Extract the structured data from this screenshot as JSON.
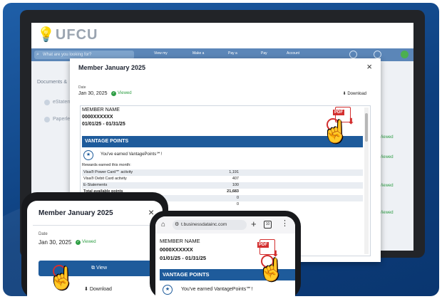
{
  "site": {
    "logo": "UFCU",
    "search_placeholder": "What are you looking for?",
    "nav": [
      "View my",
      "Make a",
      "Pay a",
      "Pay",
      "Account"
    ],
    "sidebar_title": "Documents &",
    "sidebar_items": [
      "eStatem",
      "Paperles"
    ],
    "viewed_label": "Viewed"
  },
  "modal": {
    "title": "Member January 2025",
    "close": "×",
    "date_label": "Date",
    "date": "Jan 30, 2025",
    "viewed": "Viewed",
    "download": "Download"
  },
  "statement": {
    "member_name": "MEMBER NAME",
    "account": "0000XXXXXX",
    "period": "01/01/25 - 01/31/25",
    "section_title": "VANTAGE POINTS",
    "earned_text": "You've earned VantagePoints℠!",
    "rewards_title": "Rewards earned this month:",
    "rows": [
      {
        "label": "Visa® Power Card℠ activity",
        "value": "1,191"
      },
      {
        "label": "Visa® Debit Card activity",
        "value": "407"
      },
      {
        "label": "E-Statements",
        "value": "100"
      },
      {
        "label": "Total available points",
        "value": "21,683"
      },
      {
        "label": "",
        "value": "0"
      },
      {
        "label": "",
        "value": "0"
      }
    ],
    "pdf_label": "PDF"
  },
  "phone_left": {
    "title": "Member January 2025",
    "close": "×",
    "date_label": "Date",
    "date": "Jan 30, 2025",
    "viewed": "Viewed",
    "view_button": "View",
    "download": "Download"
  },
  "phone_right": {
    "url": "t.businessdatainc.com",
    "tab_count": "10",
    "member_name": "MEMBER NAME",
    "account": "0000XXXXXX",
    "period": "01/01/25 - 01/31/25",
    "section_title": "VANTAGE POINTS",
    "earned_text": "You've earned VantagePoints℠!",
    "pdf_label": "PDF"
  },
  "colors": {
    "accent": "#1e5b9b",
    "viewed": "#2e9e44",
    "pdf": "#d32f2f",
    "background": "#0d3f7e"
  }
}
